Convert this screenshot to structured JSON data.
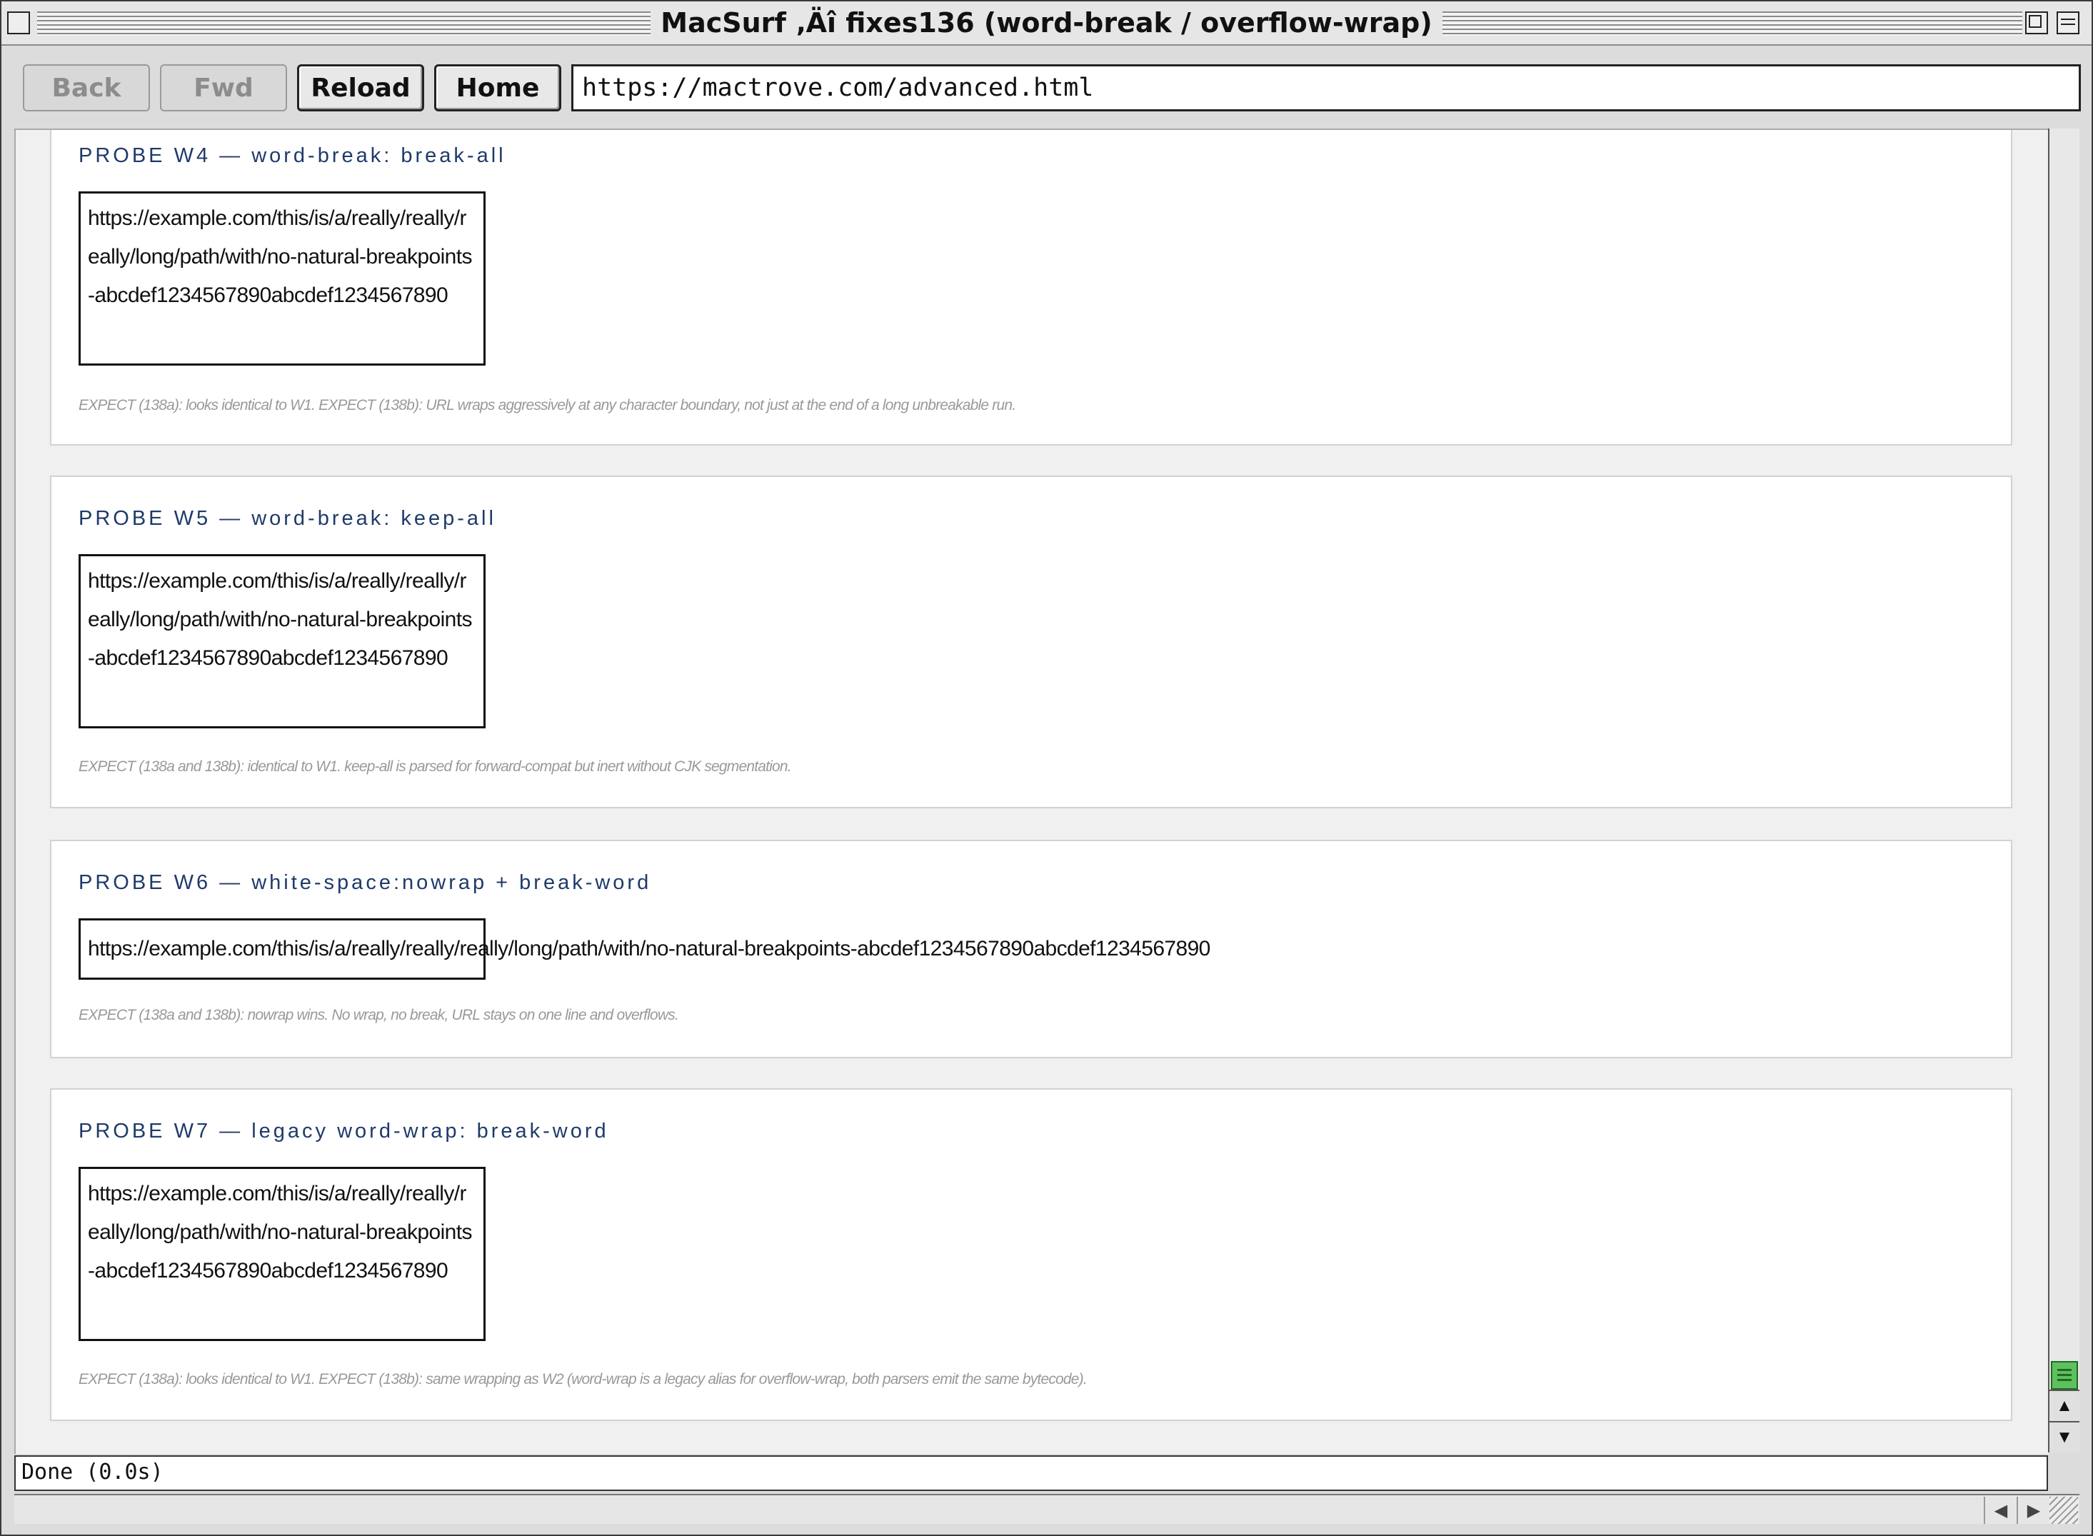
{
  "window": {
    "title": "MacSurf ‚Äî fixes136 (word-break / overflow-wrap)"
  },
  "toolbar": {
    "back_label": "Back",
    "fwd_label": "Fwd",
    "reload_label": "Reload",
    "home_label": "Home",
    "url": "https://mactrove.com/advanced.html"
  },
  "probes": [
    {
      "title": "PROBE W4 — word-break: break-all",
      "url_text": "https://example.com/this/is/a/really/really/really/long/path/with/no-natural-breakpoints-abcdef1234567890abcdef1234567890",
      "expect": "EXPECT (138a): looks identical to W1. EXPECT (138b): URL wraps aggressively at any character boundary, not just at the end of a long unbreakable run."
    },
    {
      "title": "PROBE W5 — word-break: keep-all",
      "url_text": "https://example.com/this/is/a/really/really/really/long/path/with/no-natural-breakpoints-abcdef1234567890abcdef1234567890",
      "expect": "EXPECT (138a and 138b): identical to W1. keep-all is parsed for forward-compat but inert without CJK segmentation."
    },
    {
      "title": "PROBE W6 — white-space:nowrap + break-word",
      "url_text": "https://example.com/this/is/a/really/really/really/long/path/with/no-natural-breakpoints-abcdef1234567890abcdef1234567890",
      "expect": "EXPECT (138a and 138b): nowrap wins. No wrap, no break, URL stays on one line and overflows."
    },
    {
      "title": "PROBE W7 — legacy word-wrap: break-word",
      "url_text": "https://example.com/this/is/a/really/really/really/long/path/with/no-natural-breakpoints-abcdef1234567890abcdef1234567890",
      "expect": "EXPECT (138a): looks identical to W1. EXPECT (138b): same wrapping as W2 (word-wrap is a legacy alias for overflow-wrap, both parsers emit the same bytecode)."
    }
  ],
  "status": {
    "text": "Done (0.0s)"
  },
  "colors": {
    "probe_title": "#1f3a6a",
    "scroll_thumb": "#5ec05e"
  }
}
